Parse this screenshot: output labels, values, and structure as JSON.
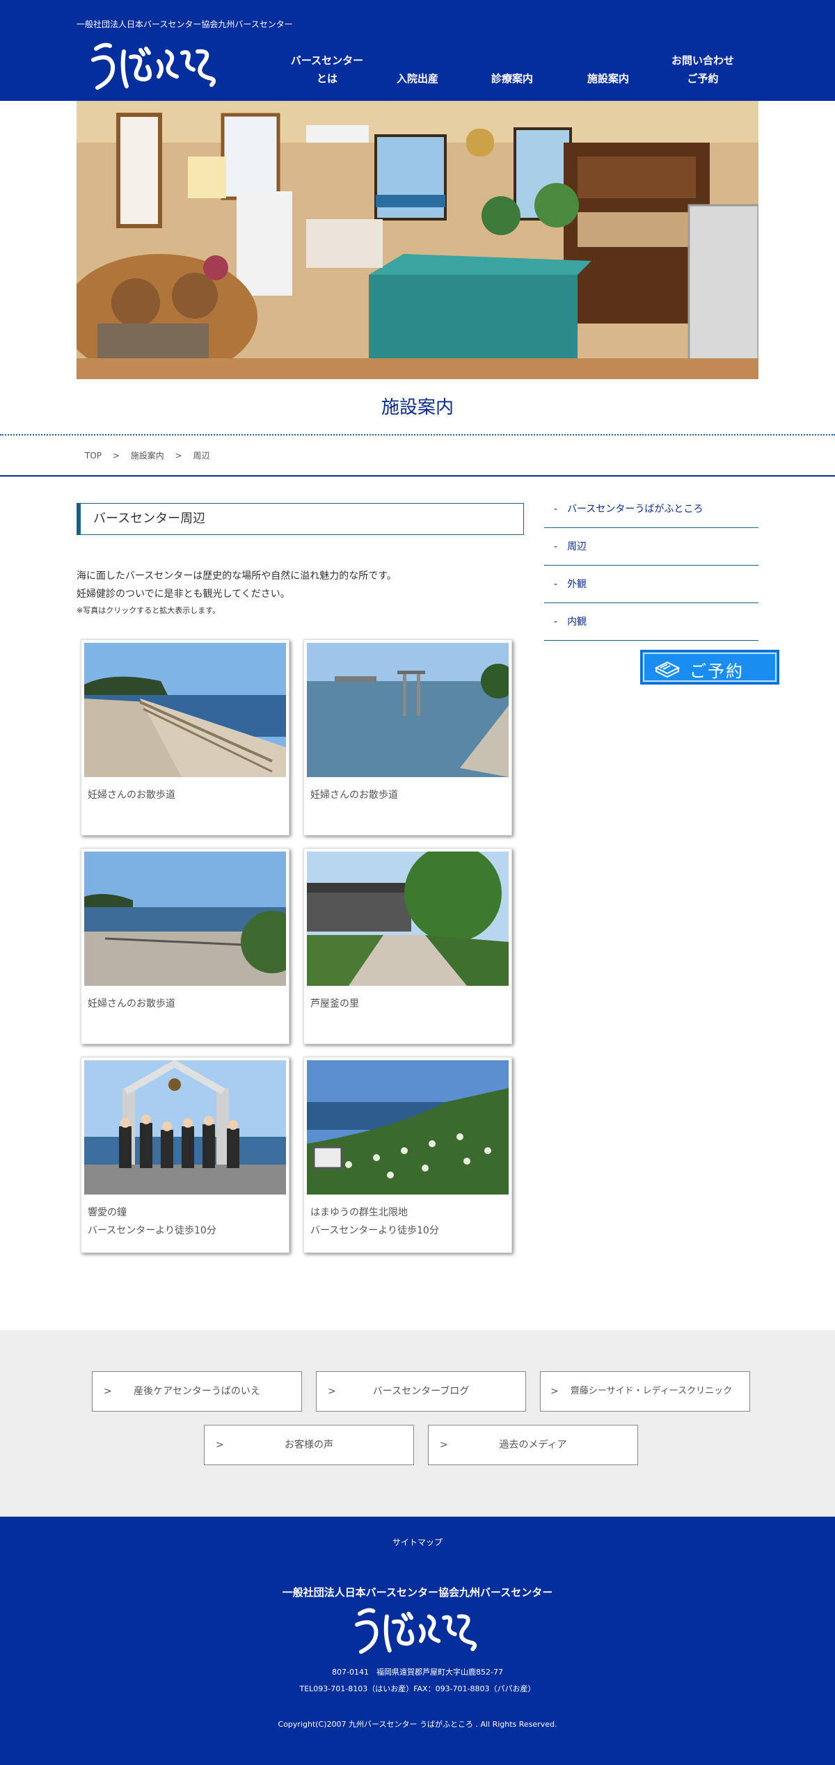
{
  "header": {
    "org_text": "一般社団法人日本バースセンター協会九州バースセンター",
    "logo_text": "うばがふところ",
    "nav": [
      {
        "line1": "バースセンター",
        "line2": "とは"
      },
      {
        "line1": "入院出産",
        "line2": ""
      },
      {
        "line1": "診療案内",
        "line2": ""
      },
      {
        "line1": "施設案内",
        "line2": ""
      },
      {
        "line1": "お問い合わせ",
        "line2": "ご予約"
      }
    ]
  },
  "page_title": "施設案内",
  "breadcrumb": {
    "items": [
      "TOP",
      "施設案内",
      "周辺"
    ],
    "separator": ">"
  },
  "section_heading": "バースセンター周辺",
  "intro": {
    "line1": "海に面したバースセンターは歴史的な場所や自然に溢れ魅力的な所です。",
    "line2": "妊婦健診のついでに是非とも観光してください。",
    "note": "※写真はクリックすると拡大表示します。"
  },
  "cards": [
    {
      "line1": "妊婦さんのお散歩道",
      "line2": ""
    },
    {
      "line1": "妊婦さんのお散歩道",
      "line2": ""
    },
    {
      "line1": "妊婦さんのお散歩道",
      "line2": ""
    },
    {
      "line1": "芦屋釜の里",
      "line2": ""
    },
    {
      "line1": "響愛の鐘",
      "line2": "バースセンターより徒歩10分"
    },
    {
      "line1": "はまゆうの群生北限地",
      "line2": "バースセンターより徒歩10分"
    }
  ],
  "sidebar": {
    "dash": "-",
    "items": [
      "バースセンターうばがふところ",
      "周辺",
      "外観",
      "内観"
    ],
    "reserve_label": "ご予約"
  },
  "links": {
    "arrow": ">",
    "items": [
      "産後ケアセンターうばのいえ",
      "バースセンターブログ",
      "齋藤シーサイド・レディースクリニック",
      "お客様の声",
      "過去のメディア"
    ]
  },
  "footer": {
    "sitemap": "サイトマップ",
    "org": "一般社団法人日本バースセンター協会九州バースセンター",
    "logo_text": "うばがふところ",
    "address": "807-0141　福岡県遠賀郡芦屋町大字山鹿852-77",
    "tel": "TEL093-701-8103（はいお産）FAX：093-701-8803（パパお産）",
    "copyright": "Copyright(C)2007 九州バースセンター うばがふところ . All Rights Reserved."
  },
  "colors": {
    "brand_blue": "#042e9c",
    "accent_teal": "#1b5f86",
    "reserve_blue": "#1a8ef0",
    "band_gray": "#eeeeee"
  }
}
